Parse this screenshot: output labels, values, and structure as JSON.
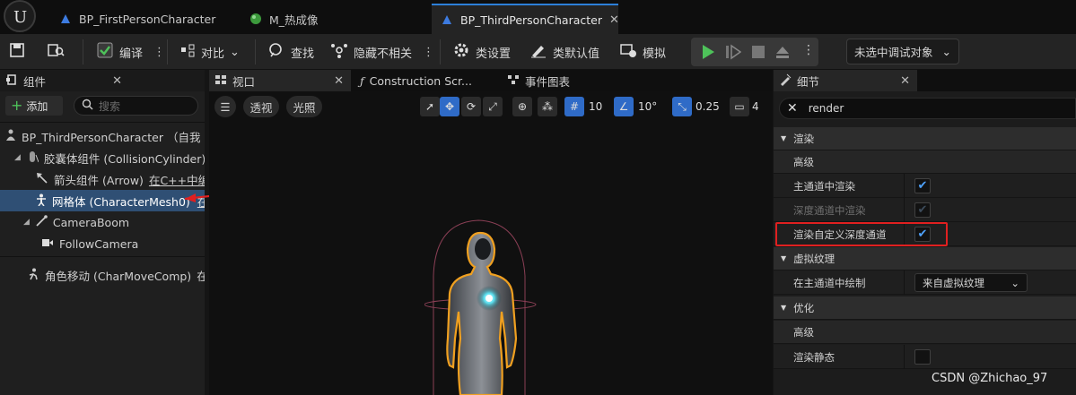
{
  "tabs": [
    {
      "label": "BP_FirstPersonCharacter",
      "icon": "blueprint-icon"
    },
    {
      "label": "M_热成像",
      "icon": "material-icon"
    },
    {
      "label": "BP_ThirdPersonCharacter",
      "icon": "blueprint-icon",
      "active": true
    }
  ],
  "toolbar": {
    "compile": "编译",
    "diff": "对比",
    "find": "查找",
    "hide_unrelated": "隐藏不相关",
    "class_settings": "类设置",
    "class_defaults": "类默认值",
    "simulate": "模拟",
    "debug_object": "未选中调试对象"
  },
  "components": {
    "title": "组件",
    "add": "添加",
    "search_placeholder": "搜索",
    "root": "BP_ThirdPersonCharacter （自我",
    "capsule": "胶囊体组件 (CollisionCylinder)",
    "arrow": "箭头组件 (Arrow)",
    "arrow_note": "在C++中编",
    "mesh": "网格体 (CharacterMesh0)",
    "mesh_note": "在",
    "camera_boom": "CameraBoom",
    "follow_camera": "FollowCamera",
    "char_move": "角色移动 (CharMoveComp)",
    "char_move_note": "在"
  },
  "viewport": {
    "tab": "视口",
    "construction_tab": "Construction Scr...",
    "event_tab": "事件图表",
    "perspective": "透视",
    "lit": "光照",
    "grid_snap": "10",
    "rot_snap": "10°",
    "scale_snap": "0.25",
    "cam_speed": "4"
  },
  "details": {
    "title": "细节",
    "search_value": "render",
    "cat_render": "渲染",
    "advanced": "高级",
    "main_pass": "主通道中渲染",
    "depth_pass": "深度通道中渲染",
    "custom_depth": "渲染自定义深度通道",
    "cat_vt": "虚拟纹理",
    "draw_main_pass": "在主通道中绘制",
    "vt_option": "来自虚拟纹理",
    "cat_optim": "优化",
    "advanced2": "高级",
    "render_static": "渲染静态",
    "main_pass_checked": true,
    "depth_pass_checked": true,
    "custom_depth_checked": true,
    "render_static_checked": false
  },
  "watermark": "CSDN @Zhichao_97",
  "colors": {
    "accent": "#2d7fd8",
    "highlight_red": "#e02020",
    "play_green": "#4ec25a",
    "selection": "#2f4f74"
  }
}
